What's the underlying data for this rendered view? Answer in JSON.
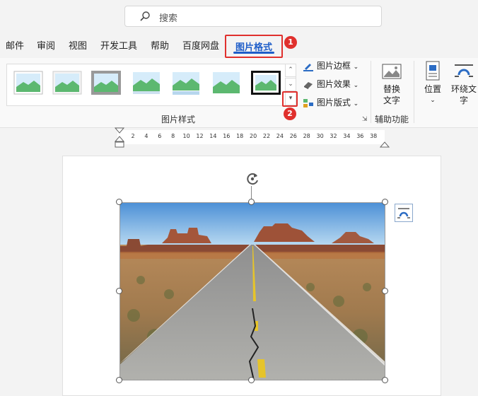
{
  "search": {
    "placeholder": "搜索",
    "icon": "search-icon"
  },
  "tabs": [
    {
      "label": "邮件"
    },
    {
      "label": "审阅"
    },
    {
      "label": "视图"
    },
    {
      "label": "开发工具"
    },
    {
      "label": "帮助"
    },
    {
      "label": "百度网盘"
    }
  ],
  "active_tab": {
    "label": "图片格式",
    "color": "#1f5ec9"
  },
  "annotations": {
    "badge1": "1",
    "badge2": "2",
    "highlight_color": "#e0302d"
  },
  "ribbon": {
    "picture_styles": {
      "group_label": "图片样式",
      "styles_count": 7
    },
    "commands": {
      "border": "图片边框",
      "effects": "图片效果",
      "layout": "图片版式"
    },
    "alt_text": {
      "line1": "替换",
      "line2": "文字",
      "group_label": "辅助功能"
    },
    "position": {
      "label": "位置"
    },
    "wrap_text": {
      "line1": "环绕文",
      "line2": "字"
    }
  },
  "ruler": {
    "ticks": [
      "2",
      "4",
      "6",
      "8",
      "10",
      "12",
      "14",
      "16",
      "18",
      "20",
      "22",
      "24",
      "26",
      "28",
      "30",
      "32",
      "34",
      "36",
      "38"
    ]
  },
  "image": {
    "description_icon": "road-landscape-image"
  }
}
